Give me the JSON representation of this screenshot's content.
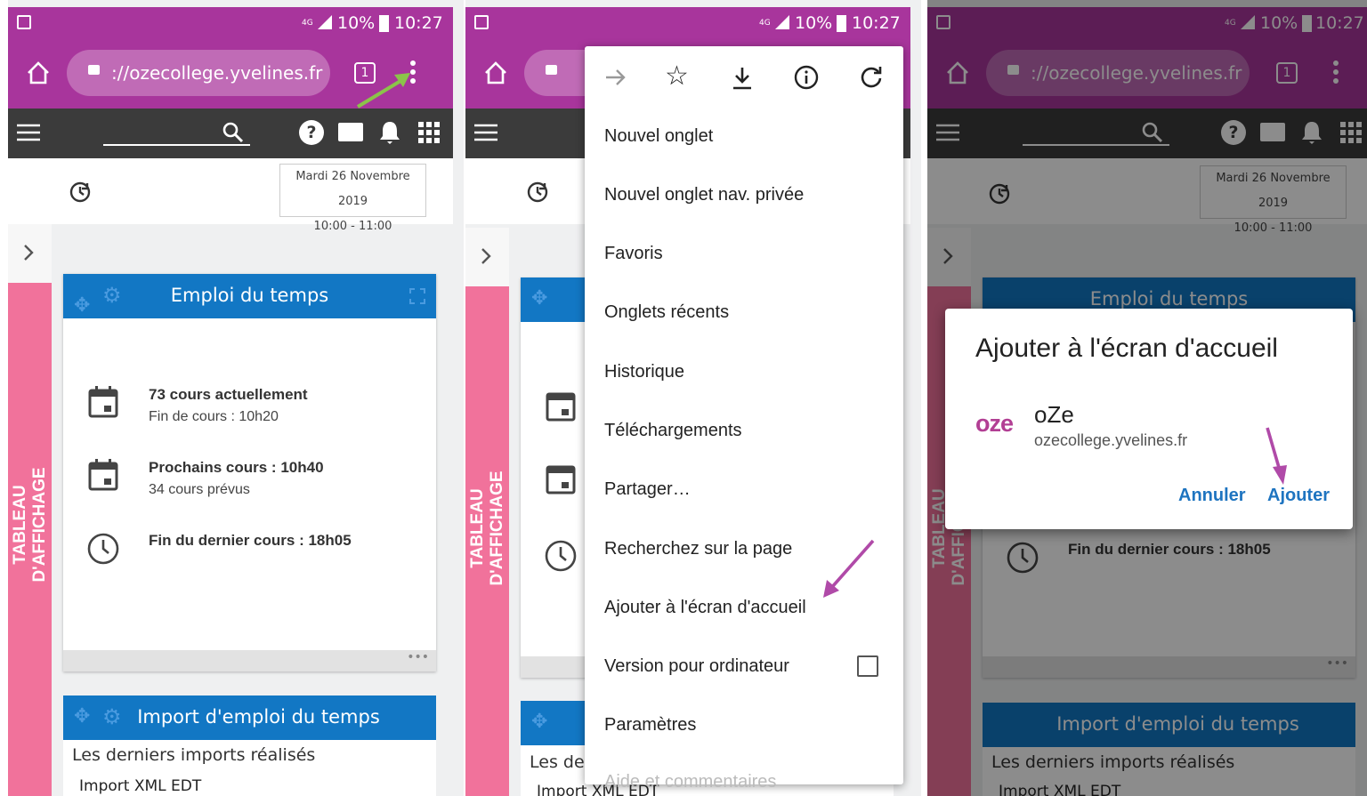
{
  "status_bar": {
    "network": "4G",
    "battery": "10%",
    "time": "10:27"
  },
  "browser": {
    "url": "://ozecollege.yvelines.fr",
    "tab_count": "1"
  },
  "date_widget": {
    "date": "Mardi 26 Novembre 2019",
    "time_range": "10:00 - 11:00"
  },
  "sidebar_label": "TABLEAU D'AFFICHAGE",
  "emploi_card": {
    "title": "Emploi du temps",
    "rows": [
      {
        "line1": "73 cours actuellement",
        "line2": "Fin de cours : 10h20"
      },
      {
        "line1": "Prochains cours : 10h40",
        "line2": "34 cours prévus"
      },
      {
        "line1": "Fin du dernier cours : 18h05",
        "line2": ""
      }
    ],
    "more": "•••"
  },
  "import_card": {
    "title": "Import d'emploi du temps",
    "subtitle": "Les derniers imports réalisés",
    "item": "Import XML EDT"
  },
  "menu": {
    "items": [
      "Nouvel onglet",
      "Nouvel onglet nav. privée",
      "Favoris",
      "Onglets récents",
      "Historique",
      "Téléchargements",
      "Partager…",
      "Recherchez sur la page",
      "Ajouter à l'écran d'accueil",
      "Version pour ordinateur",
      "Paramètres",
      "Aide et commentaires"
    ]
  },
  "dialog": {
    "title": "Ajouter à l'écran d'accueil",
    "app_name": "oZe",
    "app_url": "ozecollege.yvelines.fr",
    "logo_text": "oze",
    "cancel": "Annuler",
    "add": "Ajouter"
  },
  "colors": {
    "status_purple": "#a8359c",
    "nav_dark": "#3b3b3b",
    "card_blue": "#1277c4",
    "sidebar_pink": "#f1729b",
    "arrow_green": "#8bc34a",
    "arrow_purple": "#b04aa8",
    "dialog_button": "#1e74c0"
  }
}
